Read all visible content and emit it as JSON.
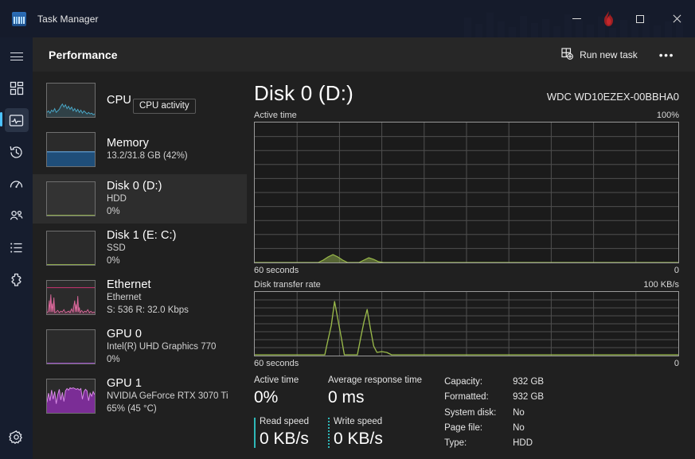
{
  "window": {
    "title": "Task Manager",
    "app_icon": "task-manager-icon",
    "controls": {
      "minimize": "minimize-icon",
      "flame": "flame-icon",
      "maximize": "maximize-icon",
      "close": "close-icon"
    }
  },
  "rail": {
    "menu_label": "hamburger-menu-icon",
    "items": [
      {
        "name": "processes",
        "icon": "grid-icon",
        "selected": false
      },
      {
        "name": "performance",
        "icon": "activity-pulse-icon",
        "selected": true
      },
      {
        "name": "app-history",
        "icon": "clock-history-icon",
        "selected": false
      },
      {
        "name": "startup-apps",
        "icon": "speedometer-icon",
        "selected": false
      },
      {
        "name": "users",
        "icon": "users-icon",
        "selected": false
      },
      {
        "name": "details",
        "icon": "list-icon",
        "selected": false
      },
      {
        "name": "services",
        "icon": "services-gear-icon",
        "selected": false
      }
    ],
    "settings": {
      "name": "settings",
      "icon": "gear-icon"
    }
  },
  "toolbar": {
    "title": "Performance",
    "run_new_task": "Run new task",
    "run_new_task_icon": "new-task-icon",
    "more_options": "•••"
  },
  "tooltip": {
    "text": "CPU activity"
  },
  "resources": [
    {
      "id": "cpu",
      "title": "CPU",
      "sub1": "",
      "sub2": "",
      "selected": false,
      "graph": "line",
      "color": "#4aa8c8"
    },
    {
      "id": "memory",
      "title": "Memory",
      "sub1": "13.2/31.8 GB (42%)",
      "sub2": "",
      "selected": false,
      "graph": "fill",
      "color": "#1f4e79",
      "fill_pct": 42
    },
    {
      "id": "disk-0",
      "title": "Disk 0 (D:)",
      "sub1": "HDD",
      "sub2": "0%",
      "selected": true,
      "graph": "flat",
      "color": "#8aa64a"
    },
    {
      "id": "disk-1",
      "title": "Disk 1 (E: C:)",
      "sub1": "SSD",
      "sub2": "0%",
      "selected": false,
      "graph": "flat",
      "color": "#8aa64a"
    },
    {
      "id": "ethernet",
      "title": "Ethernet",
      "sub1": "Ethernet",
      "sub2": "S: 536 R: 32.0 Kbps",
      "selected": false,
      "graph": "spikes",
      "color": "#c8528c"
    },
    {
      "id": "gpu-0",
      "title": "GPU 0",
      "sub1": "Intel(R) UHD Graphics 770",
      "sub2": "0%",
      "selected": false,
      "graph": "flat",
      "color": "#9b4fc8"
    },
    {
      "id": "gpu-1",
      "title": "GPU 1",
      "sub1": "NVIDIA GeForce RTX 3070 Ti",
      "sub2": "65%  (45 °C)",
      "selected": false,
      "graph": "area",
      "color": "#c45ad6"
    }
  ],
  "detail": {
    "title": "Disk 0 (D:)",
    "model": "WDC WD10EZEX-00BBHA0",
    "active_graph": {
      "caption_left": "Active time",
      "caption_right": "100%",
      "foot_left": "60 seconds",
      "foot_right": "0"
    },
    "rate_graph": {
      "caption_left": "Disk transfer rate",
      "caption_right": "100 KB/s",
      "foot_left": "60 seconds",
      "foot_right": "0"
    },
    "stats": {
      "active_time_label": "Active time",
      "active_time_value": "0%",
      "read_speed_label": "Read speed",
      "read_speed_value": "0 KB/s",
      "avg_response_label": "Average response time",
      "avg_response_value": "0 ms",
      "write_speed_label": "Write speed",
      "write_speed_value": "0 KB/s",
      "info": [
        {
          "key": "Capacity:",
          "value": "932 GB"
        },
        {
          "key": "Formatted:",
          "value": "932 GB"
        },
        {
          "key": "System disk:",
          "value": "No"
        },
        {
          "key": "Page file:",
          "value": "No"
        },
        {
          "key": "Type:",
          "value": "HDD"
        }
      ]
    }
  },
  "chart_data": [
    {
      "type": "area",
      "name": "disk-active-time",
      "title": "Active time",
      "ylabel": "Active time",
      "xlabel": "60 seconds",
      "ylim": [
        0,
        100
      ],
      "yticks": [
        "0",
        "100%"
      ],
      "grid": true,
      "grid_cols": 10,
      "grid_rows": 10,
      "series_color": "#8aa64a",
      "x": [
        0,
        5,
        10,
        15,
        18,
        20,
        22,
        24,
        26,
        28,
        30,
        32,
        34,
        36,
        38,
        40,
        45,
        50,
        55,
        60
      ],
      "values": [
        0,
        0,
        0,
        0,
        0,
        1,
        3,
        4,
        3,
        1,
        0,
        0,
        2,
        3,
        2,
        0,
        0,
        0,
        0,
        0
      ]
    },
    {
      "type": "line",
      "name": "disk-transfer-rate",
      "title": "Disk transfer rate",
      "ylabel": "Disk transfer rate",
      "xlabel": "60 seconds",
      "ylim": [
        0,
        100
      ],
      "yticks": [
        "0",
        "100 KB/s"
      ],
      "grid": true,
      "grid_cols": 10,
      "grid_rows": 8,
      "series_color": "#9aba4a",
      "x": [
        0,
        10,
        14,
        16,
        18,
        20,
        22,
        24,
        26,
        28,
        30,
        32,
        40,
        50,
        60
      ],
      "values": [
        0,
        0,
        0,
        0,
        88,
        0,
        0,
        0,
        72,
        0,
        6,
        4,
        0,
        0,
        0
      ]
    }
  ]
}
